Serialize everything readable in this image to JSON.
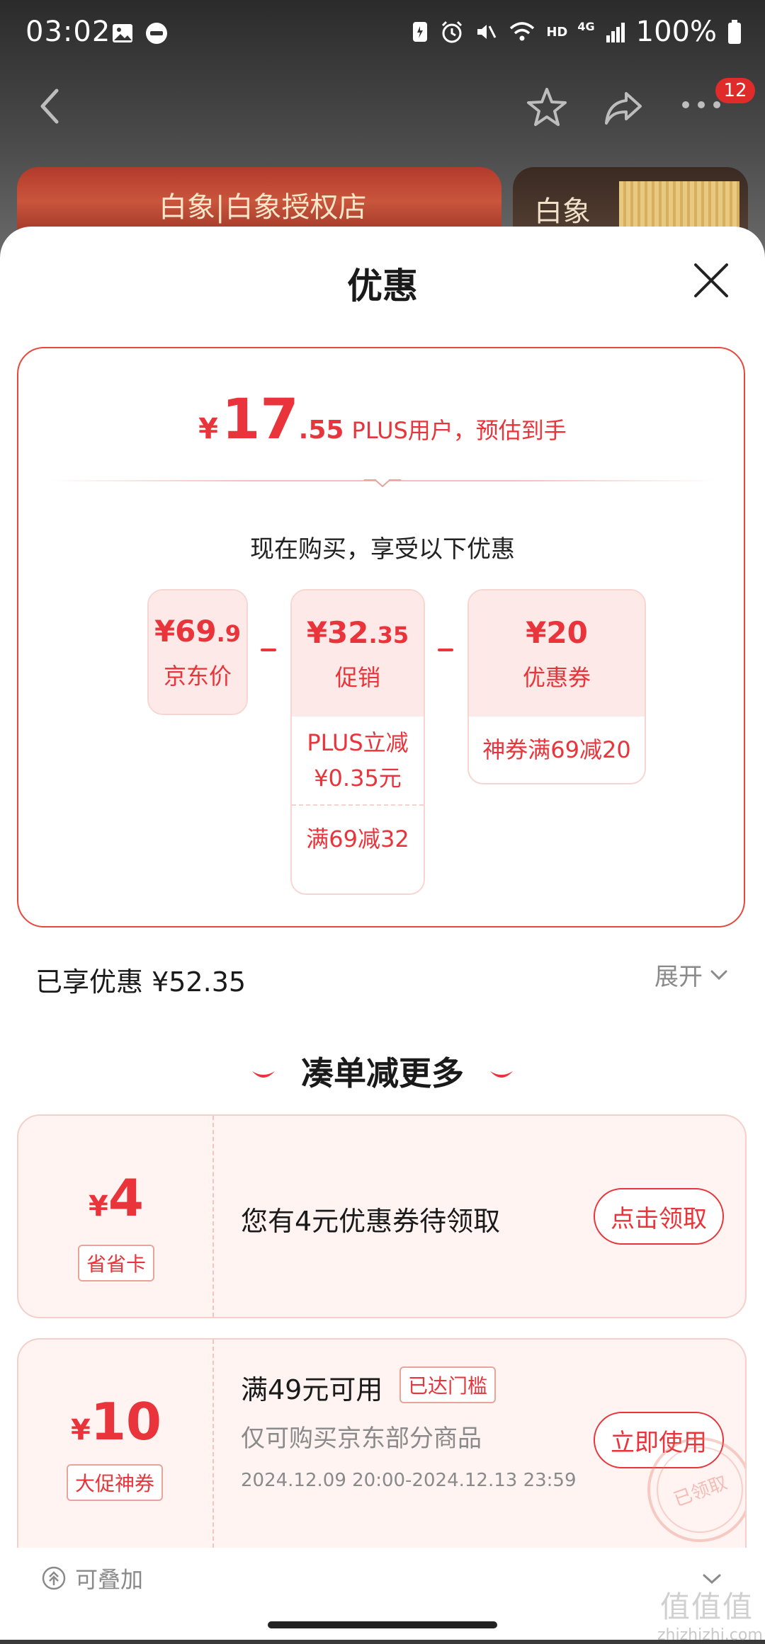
{
  "status_bar": {
    "time": "03:02",
    "network": "4G",
    "hd": "HD",
    "battery": "100%"
  },
  "nav": {
    "badge": "12"
  },
  "banners": {
    "left_text": "白象|白象授权店",
    "right_text": "白象"
  },
  "sheet": {
    "title": "优惠"
  },
  "price_card": {
    "currency": "¥",
    "price_int": "17",
    "price_dec": ".55",
    "price_label": "PLUS用户，预估到手",
    "subtitle": "现在购买，享受以下优惠",
    "items": [
      {
        "amount_int": "¥69",
        "amount_dec": ".9",
        "label": "京东价"
      },
      {
        "amount_int": "¥32",
        "amount_dec": ".35",
        "label": "促销",
        "details": [
          "PLUS立减\n¥0.35元",
          "满69减32"
        ]
      },
      {
        "amount_int": "¥20",
        "amount_dec": "",
        "label": "优惠券",
        "details": [
          "神券满69减20"
        ]
      }
    ],
    "detail_plus_line1": "PLUS立减",
    "detail_plus_line2": "¥0.35元",
    "detail_promo": "满69减32",
    "detail_coupon": "神券满69减20"
  },
  "enjoyed": {
    "label": "已享优惠 ¥52.35",
    "expand": "展开"
  },
  "section": {
    "title": "凑单减更多"
  },
  "coupons": [
    {
      "symbol": "¥",
      "amount": "4",
      "tag": "省省卡",
      "text": "您有4元优惠券待领取",
      "button": "点击领取"
    },
    {
      "symbol": "¥",
      "amount": "10",
      "tag": "大促神券",
      "condition": "满49元可用",
      "reached": "已达门槛",
      "scope": "仅可购买京东部分商品",
      "date": "2024.12.09 20:00-2024.12.13 23:59",
      "button": "立即使用",
      "stamp": "已领取"
    }
  ],
  "stackable": {
    "label": "可叠加"
  },
  "watermark": {
    "big": "值值值",
    "small": "zhizhizhi.com"
  }
}
